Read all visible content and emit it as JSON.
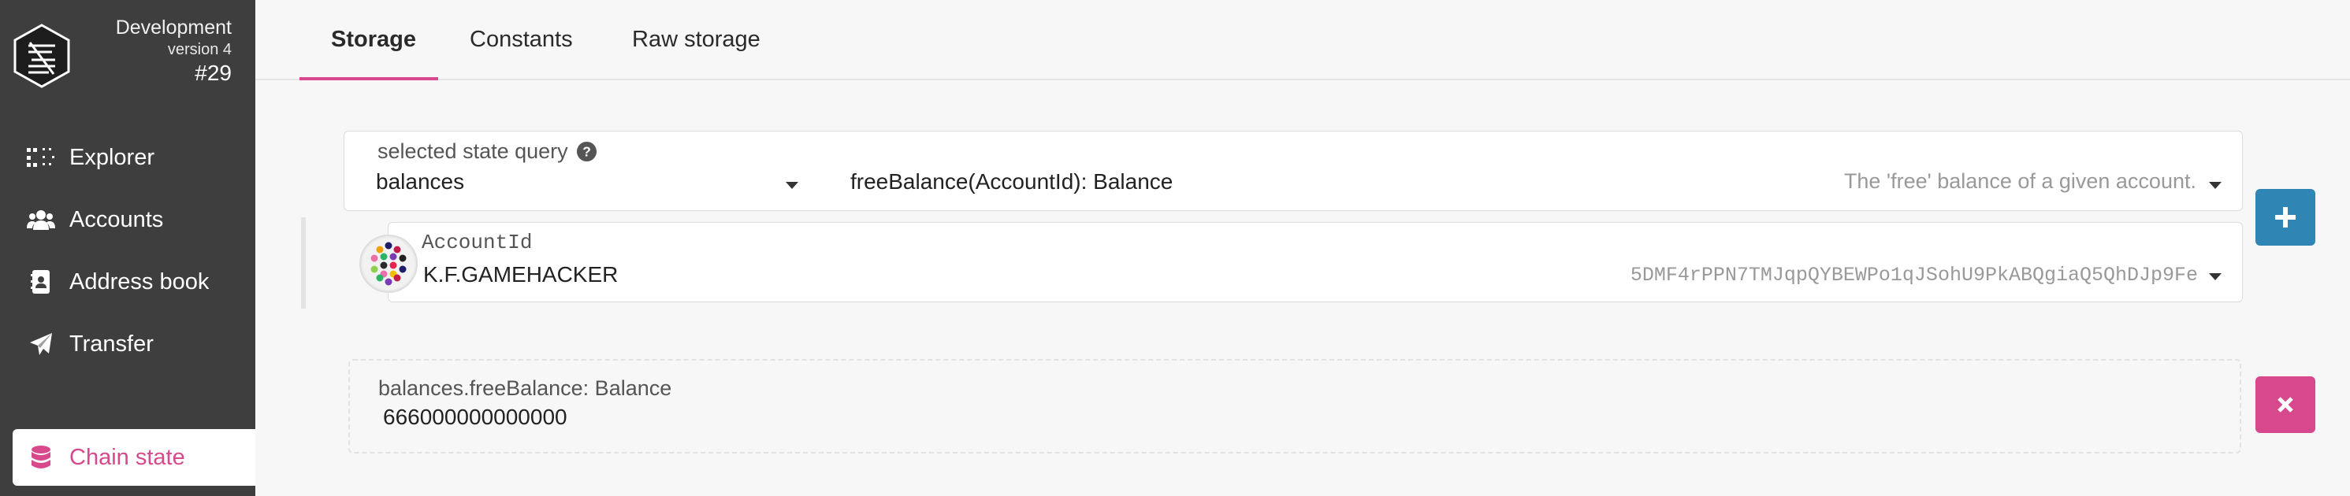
{
  "sidebar": {
    "chain": {
      "name": "Development",
      "version": "version 4",
      "block": "#29"
    },
    "items": [
      {
        "label": "Explorer",
        "icon": "grid-icon"
      },
      {
        "label": "Accounts",
        "icon": "users-icon"
      },
      {
        "label": "Address book",
        "icon": "address-book-icon"
      },
      {
        "label": "Transfer",
        "icon": "paper-plane-icon"
      },
      {
        "label": "Chain state",
        "icon": "database-icon",
        "active": true
      }
    ],
    "accent": "#d8488d"
  },
  "tabs": [
    {
      "label": "Storage",
      "active": true
    },
    {
      "label": "Constants"
    },
    {
      "label": "Raw storage"
    }
  ],
  "query": {
    "label": "selected state query",
    "module": "balances",
    "method": "freeBalance(AccountId): Balance",
    "description": "The 'free' balance of a given account."
  },
  "param": {
    "label": "AccountId",
    "value": "K.F.GAMEHACKER",
    "address": "5DMF4rPPN7TMJqpQYBEWPo1qJSohU9PkABQgiaQ5QhDJp9Fe"
  },
  "result": {
    "label": "balances.freeBalance: Balance",
    "value": "666000000000000"
  },
  "buttons": {
    "add_color": "#2f86b5",
    "remove_color": "#d8488d"
  }
}
